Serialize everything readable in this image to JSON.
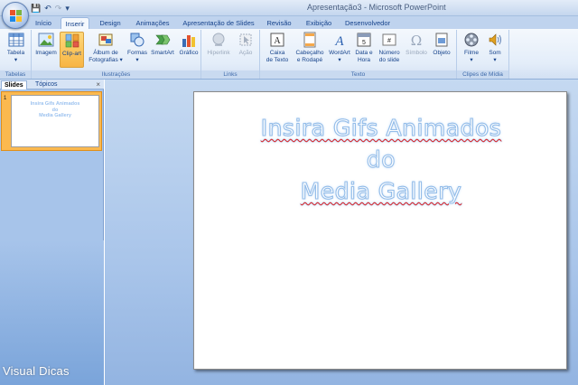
{
  "window": {
    "title": "Apresentação3 - Microsoft PowerPoint"
  },
  "qat": {
    "save": "💾",
    "undo": "↶",
    "redo": "↷",
    "more": "▾"
  },
  "tabs": [
    "Início",
    "Inserir",
    "Design",
    "Animações",
    "Apresentação de Slides",
    "Revisão",
    "Exibição",
    "Desenvolvedor"
  ],
  "ribbon": {
    "groups": {
      "tabelas": "Tabelas",
      "ilustracoes": "Ilustrações",
      "links": "Links",
      "texto": "Texto",
      "clipes": "Clipes de Mídia"
    },
    "buttons": {
      "tabela": [
        "Tabela",
        "▾"
      ],
      "imagem": [
        "Imagem"
      ],
      "clipart": [
        "Clip-art"
      ],
      "album": [
        "Álbum de",
        "Fotografias ▾"
      ],
      "formas": [
        "Formas",
        "▾"
      ],
      "smartart": [
        "SmartArt"
      ],
      "grafico": [
        "Gráfico"
      ],
      "hiperlink": [
        "Hiperlink"
      ],
      "acao": [
        "Ação"
      ],
      "caixatexto": [
        "Caixa",
        "de Texto"
      ],
      "cabecalho": [
        "Cabeçalho",
        "e Rodapé"
      ],
      "wordart": [
        "WordArt",
        "▾"
      ],
      "datahora": [
        "Data e",
        "Hora"
      ],
      "numero": [
        "Número",
        "do slide"
      ],
      "simbolo": [
        "Símbolo"
      ],
      "objeto": [
        "Objeto"
      ],
      "filme": [
        "Filme",
        "▾"
      ],
      "som": [
        "Som",
        "▾"
      ]
    }
  },
  "pane": {
    "tabs": [
      "Slides",
      "Tópicos"
    ],
    "close": "×",
    "thumbnail": {
      "number": "1",
      "lines": [
        "Insira Gifs Animados",
        "do",
        "Media Gallery"
      ]
    }
  },
  "slide": {
    "lines": [
      "Insira Gifs Animados",
      "do",
      "Media Gallery"
    ]
  },
  "watermark": "Visual Dicas",
  "colors": {
    "accent": "#15428b",
    "selected": "#f7b544",
    "title_outline": "#94bde9"
  }
}
